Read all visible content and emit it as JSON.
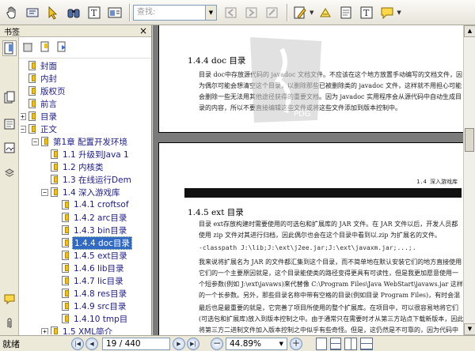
{
  "toolbar": {
    "search_placeholder": "查找:",
    "tools": [
      "hand-tool-icon",
      "select-text-icon",
      "pointer-icon",
      "binoculars-icon",
      "text-select-icon",
      "snapshot-icon",
      "highlight-icon",
      "note-icon",
      "page-icon",
      "text-box-icon",
      "comment-icon"
    ]
  },
  "panel": {
    "title": "书签",
    "close": "×"
  },
  "bookmarks": [
    {
      "label": "封面",
      "level": 1,
      "expander": ""
    },
    {
      "label": "内封",
      "level": 1,
      "expander": ""
    },
    {
      "label": "版权页",
      "level": 1,
      "expander": ""
    },
    {
      "label": "前言",
      "level": 1,
      "expander": ""
    },
    {
      "label": "目录",
      "level": 1,
      "expander": "+"
    },
    {
      "label": "正文",
      "level": 1,
      "expander": "−"
    },
    {
      "label": "第1章 配置开发环境",
      "level": 2,
      "expander": "−"
    },
    {
      "label": "1.1 升级到Java 1",
      "level": 3,
      "expander": ""
    },
    {
      "label": "1.2 内核类",
      "level": 3,
      "expander": ""
    },
    {
      "label": "1.3 在线运行Dem",
      "level": 3,
      "expander": ""
    },
    {
      "label": "1.4 深入游戏库",
      "level": 3,
      "expander": "−"
    },
    {
      "label": "1.4.1 croftsof",
      "level": 4,
      "expander": ""
    },
    {
      "label": "1.4.2 arc目录",
      "level": 4,
      "expander": ""
    },
    {
      "label": "1.4.3 bin目录",
      "level": 4,
      "expander": ""
    },
    {
      "label": "1.4.4 doc目录",
      "level": 4,
      "expander": "",
      "selected": true
    },
    {
      "label": "1.4.5 ext目录",
      "level": 4,
      "expander": ""
    },
    {
      "label": "1.4.6 lib目录",
      "level": 4,
      "expander": ""
    },
    {
      "label": "1.4.7 lic目录",
      "level": 4,
      "expander": ""
    },
    {
      "label": "1.4.8 res目录",
      "level": 4,
      "expander": ""
    },
    {
      "label": "1.4.9 src目录",
      "level": 4,
      "expander": ""
    },
    {
      "label": "1.4.10 tmp目",
      "level": 4,
      "expander": ""
    },
    {
      "label": "1.5 XML简介",
      "level": 3,
      "expander": "+"
    }
  ],
  "page1": {
    "heading": "1.4.4   doc 目录",
    "para": "目录 doc中存放源代码的 javadoc 文档文件。不应该在这个地方放置手动编写的文档文件，因为偶尔可能会想清空这个目录，以删除那些已被删除类的 javadoc 文件，这样就不用担心可能会删除一些无法用其他途径获得的重要文档。因为 javadoc 实用程序会从源代码中自动生成目录的内容，所以不要直接编辑这些文件或将这些文件添加到版本控制中。"
  },
  "page2": {
    "chapter_tag": "1.4  深入游戏库",
    "heading": "1.4.5   ext 目录",
    "para1": "目录 ext存放构建时需要使用的可选包和扩展库的 JAR 文件。在 JAR 文件以后，开发人员都使用 zip 文件对其进行归档，因此偶尔也会在这个目录中看到以.zip 为扩展名的文件。",
    "code": "-classpath J:\\lib;J:\\ext\\j2ee.jar;J:\\ext\\javaxm.jar;...;.",
    "para2": "我来说将扩展名为 JAR 的文件都汇集到这个目录，而不简单地在默认安装它们的地方直接使用它们的一个主要原因就是，这个目录能使类的路径变得更具有可读性，但是我更加愿意使用一个短参数(例如 J:\\ext\\javaws)来代替像 C:\\Program Files\\Java WebStart\\javaws.jar 这样的一个长参数。另外，那些目录名称中带有空格的目录(例如目录 Program Files)，有时会混淆在类路径中使用这种目录的应用程序。",
    "para3": "最后也是最重要的就是，它完善了项目所使用的整个扩展库。在项目中，可以很容易地将它们(可选包和扩展库)放入到版本控制之中。由于通常只在需要时才从第三方站点下载新版本，因此将第三方二进制文件加入版本控制之中似乎有些奇怪。但是，这仍然是不可靠的，因为代码中可能需要使用较早的版本库，而这些较早的版本库在供应商的站点上又不再进行发布了。"
  },
  "status": {
    "ready": "就绪",
    "page": "19 / 440",
    "zoom": "44.89%"
  },
  "colors": {
    "selection": "#316ac5",
    "bookmark_text": "#1c1c8c",
    "doc_bg": "#7b7b7b"
  }
}
